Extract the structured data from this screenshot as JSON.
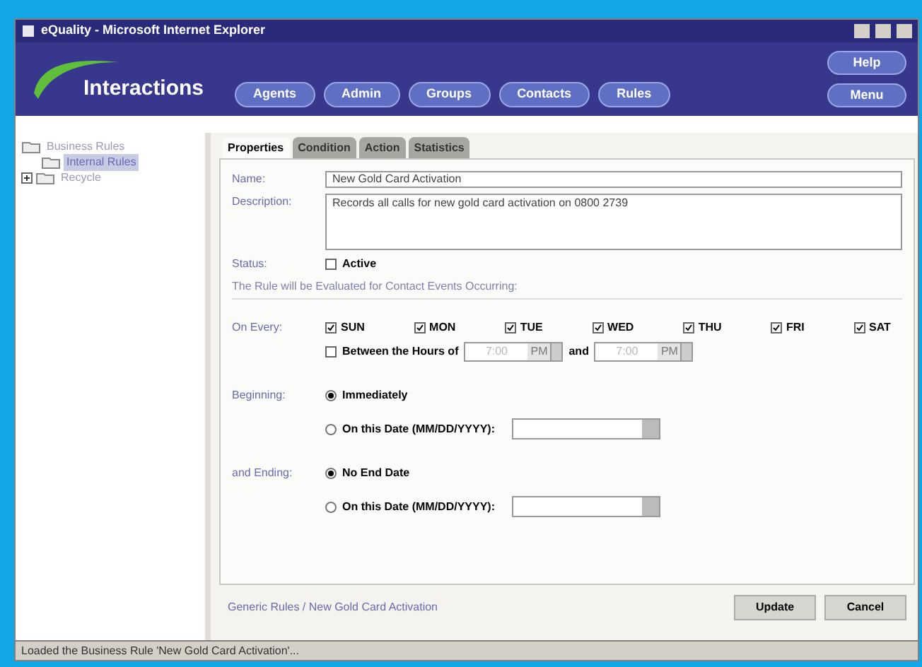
{
  "window": {
    "title": "eQuality - Microsoft Internet Explorer"
  },
  "header": {
    "logo": "Interactions",
    "nav": [
      "Agents",
      "Admin",
      "Groups",
      "Contacts",
      "Rules"
    ],
    "side_buttons": [
      "Help",
      "Menu"
    ]
  },
  "tree": [
    {
      "label": "Business Rules",
      "selected": false,
      "expanded": true,
      "children": [
        {
          "label": "Internal Rules",
          "selected": true
        }
      ]
    },
    {
      "label": "Recycle",
      "selected": false,
      "expanded": false
    }
  ],
  "tabs": [
    {
      "label": "Properties",
      "selected": true
    },
    {
      "label": "Condition",
      "selected": false
    },
    {
      "label": "Action",
      "selected": false
    },
    {
      "label": "Statistics",
      "selected": false
    }
  ],
  "form": {
    "name_label": "Name:",
    "name_value": "New Gold Card Activation",
    "description_label": "Description:",
    "description_value": "Records all calls for new gold card activation on 0800 2739",
    "status_label": "Status:",
    "status_option": {
      "label": "Active",
      "checked": false
    },
    "evaluation_heading": "The Rule will be Evaluated for Contact Events Occurring:",
    "on_every_label": "On Every:",
    "days": [
      {
        "label": "SUN",
        "checked": true
      },
      {
        "label": "MON",
        "checked": true
      },
      {
        "label": "TUE",
        "checked": true
      },
      {
        "label": "WED",
        "checked": true
      },
      {
        "label": "THU",
        "checked": true
      },
      {
        "label": "FRI",
        "checked": true
      },
      {
        "label": "SAT",
        "checked": true
      }
    ],
    "hours": {
      "label": "Between the Hours of",
      "checked": false,
      "start_time": "7:00",
      "start_ampm": "PM",
      "joiner": "and",
      "end_time": "7:00",
      "end_ampm": "PM"
    },
    "beginning_label": "Beginning:",
    "beginning_options": [
      {
        "label": "Immediately",
        "selected": true,
        "kind": "plain"
      },
      {
        "label": "On this Date (MM/DD/YYYY):",
        "selected": false,
        "kind": "date"
      }
    ],
    "ending_label": "and Ending:",
    "ending_options": [
      {
        "label": "No End Date",
        "selected": true,
        "kind": "plain"
      },
      {
        "label": "On this Date (MM/DD/YYYY):",
        "selected": false,
        "kind": "date"
      }
    ]
  },
  "footer": {
    "breadcrumb": "Generic Rules / New Gold Card Activation",
    "buttons": [
      "Update",
      "Cancel"
    ]
  },
  "status_bar": "Loaded the Business Rule 'New Gold Card Activation'..."
}
